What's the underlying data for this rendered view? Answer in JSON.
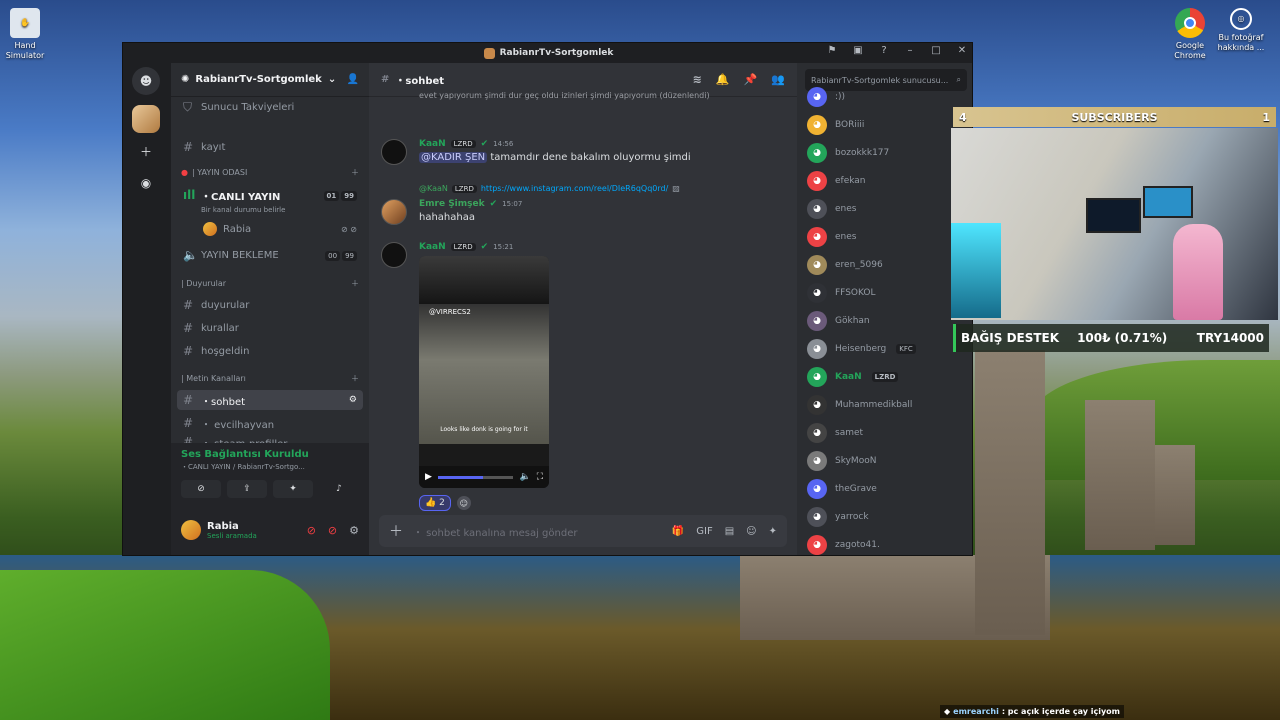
{
  "desktop": {
    "icons": [
      {
        "label": "Hand Simulator"
      },
      {
        "label": "Google Chrome"
      },
      {
        "label": "Bu fotoğraf hakkında ..."
      }
    ]
  },
  "window": {
    "title": "RabianrTv-Sortgomlek"
  },
  "server": {
    "name": "RabianrTv-Sortgomlek",
    "boosts": "Sunucu Takviyeleri"
  },
  "channels": {
    "kayit": "kayıt",
    "cat_yayin": "| YAYIN ODASI",
    "canli_yayin": "・CANLI YAYIN",
    "canli_count_a": "01",
    "canli_count_b": "99",
    "canli_status": "Bir kanal durumu belirle",
    "voice_user": "Rabia",
    "yayin_bekleme": "YAYIN BEKLEME",
    "bekleme_count_a": "00",
    "bekleme_count_b": "99",
    "cat_duyurular": "| Duyurular",
    "duyurular": "duyurular",
    "kurallar": "kurallar",
    "hosgeldin": "hoşgeldin",
    "cat_metin": "| Metin Kanalları",
    "sohbet": "・sohbet",
    "evcilhayvan": "・ evcilhayvan",
    "steam": "・ steam-profiller"
  },
  "voice_panel": {
    "title": "Ses Bağlantısı Kuruldu",
    "sub": "・CANLI YAYIN / RabianrTv-Sortgo..."
  },
  "user": {
    "name": "Rabia",
    "status": "Sesli aramada"
  },
  "chat": {
    "channel": "・sohbet",
    "prev_line": "evet yapıyorum şimdi dur geç oldu izinleri şimdi yapıyorum (düzenlendi)",
    "messages": [
      {
        "author": "KaaN",
        "tag": "LZRD",
        "time": "14:56",
        "mention": "@KADIR ŞEN",
        "text": "tamamdır dene bakalım oluyormu şimdi"
      },
      {
        "reply_author": "@KaaN",
        "reply_tag": "LZRD",
        "reply_link": "https://www.instagram.com/reel/DIeR6qQq0rd/",
        "author": "Emre Şimşek",
        "time": "15:07",
        "text": "hahahahaa"
      },
      {
        "author": "KaaN",
        "tag": "LZRD",
        "time": "15:21"
      }
    ],
    "video_handle": "@VIRRECS2",
    "video_caption": "Looks like donk is going for it",
    "reaction_count": "2",
    "composer_placeholder": "・ sohbet kanalına mesaj gönder",
    "video_progress": 0.6
  },
  "members": {
    "search_placeholder": "RabianrTv-Sortgomlek sunucusu...",
    "list": [
      ":))",
      "BORiiii",
      "bozokkk177",
      "efekan",
      "enes",
      "enes",
      "eren_5096",
      "FFSOKOL",
      "Gökhan",
      "Heisenberg",
      "KaaN",
      "Muhammedikball",
      "samet",
      "SkyMooN",
      "theGrave",
      "yarrock",
      "zagoto41."
    ],
    "heisenberg_tag": "KFC",
    "kaan_tag": "LZRD"
  },
  "overlay": {
    "sub_left": "4",
    "sub_title": "SUBSCRIBERS",
    "sub_right": "1",
    "donate_label": "BAĞIŞ DESTEK",
    "donate_amount": "100₺ (0.71%)",
    "donate_goal": "TRY14000",
    "chat_user": "emrearchi",
    "chat_text": ": pc açık içerde çay içiyom"
  }
}
